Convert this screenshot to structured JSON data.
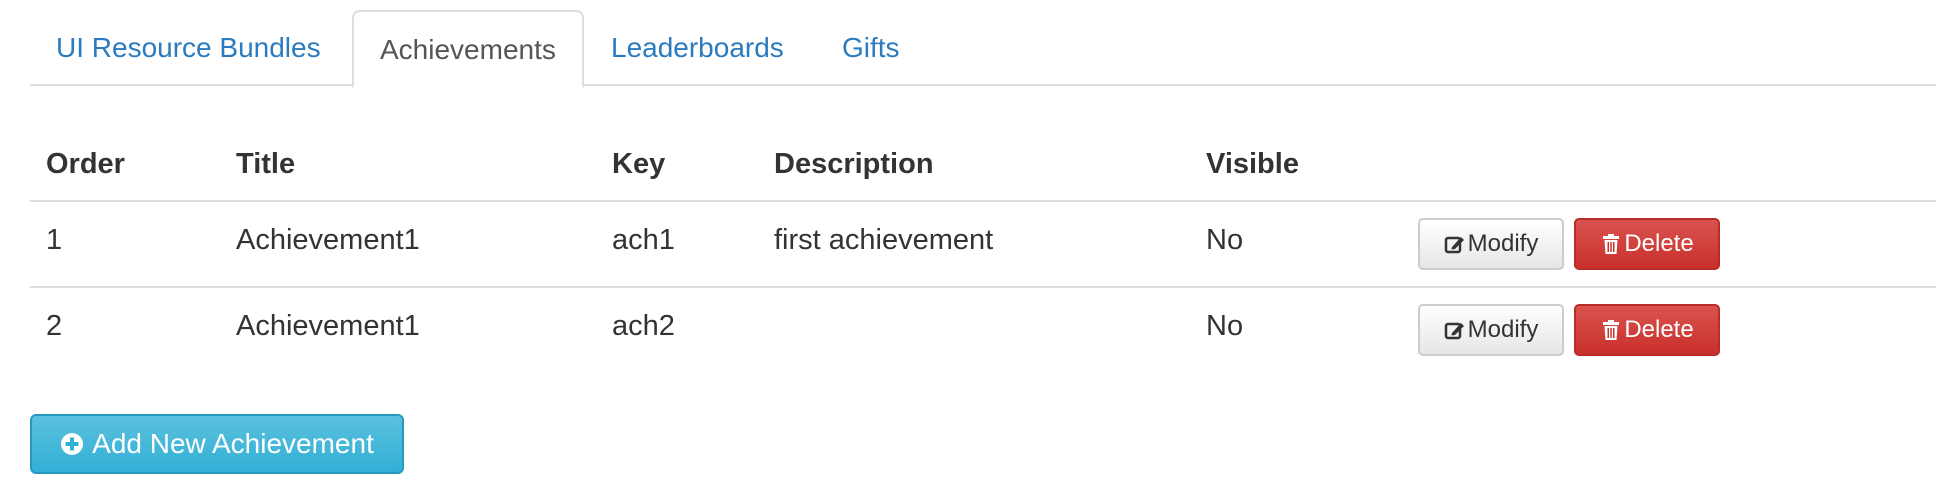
{
  "tabs": [
    {
      "label": "UI Resource Bundles",
      "active": false
    },
    {
      "label": "Achievements",
      "active": true
    },
    {
      "label": "Leaderboards",
      "active": false
    },
    {
      "label": "Gifts",
      "active": false
    }
  ],
  "table": {
    "headers": {
      "order": "Order",
      "title": "Title",
      "key": "Key",
      "description": "Description",
      "visible": "Visible"
    },
    "rows": [
      {
        "order": "1",
        "title": "Achievement1",
        "key": "ach1",
        "description": "first achievement",
        "visible": "No"
      },
      {
        "order": "2",
        "title": "Achievement1",
        "key": "ach2",
        "description": "",
        "visible": "No"
      }
    ]
  },
  "actions": {
    "modify_label": "Modify",
    "delete_label": "Delete",
    "modify_icon": "edit-icon",
    "delete_icon": "trash-icon"
  },
  "add_button": {
    "label": "Add New Achievement",
    "icon": "plus-circle-icon"
  },
  "colors": {
    "link": "#2a7bbf",
    "danger": "#d9534f",
    "info": "#5bc0de"
  }
}
